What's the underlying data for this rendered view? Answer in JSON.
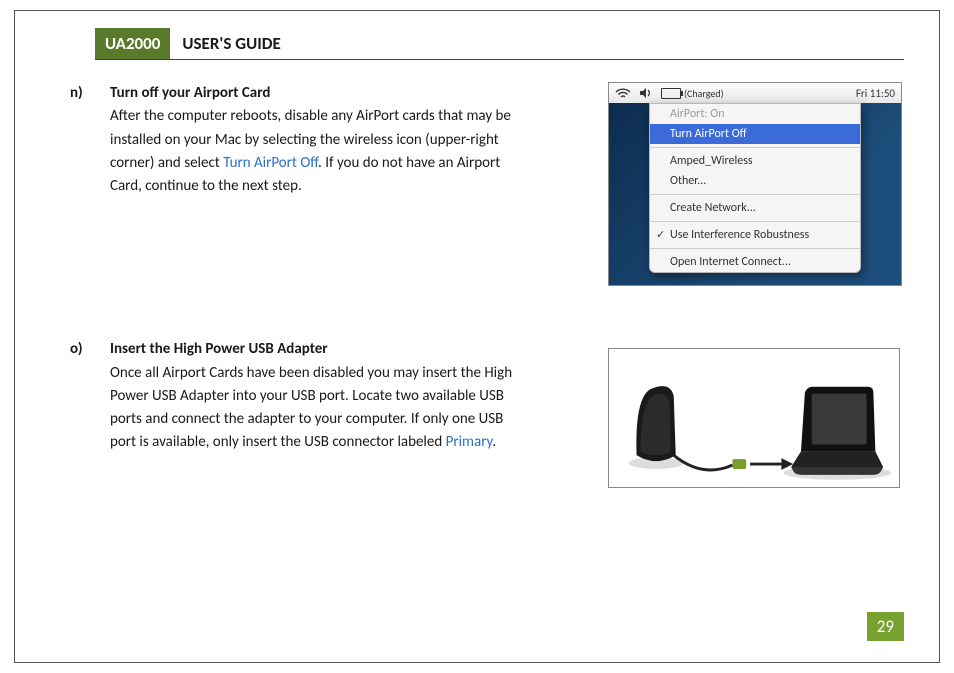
{
  "header": {
    "product": "UA2000",
    "title": "USER'S GUIDE"
  },
  "step_n": {
    "letter": "n)",
    "title": "Turn off your Airport Card",
    "body_pre": "After the computer reboots, disable any AirPort cards that may be installed on your Mac by selecting the wireless icon (upper-right corner) and select ",
    "link": "Turn AirPort Off",
    "body_post": ". If you do not have an Airport Card, continue to the next step."
  },
  "mac_menu": {
    "battery_text": "(Charged)",
    "clock": "Fri 11:50",
    "items": {
      "status": "AirPort: On",
      "turn_off": "Turn AirPort Off",
      "network1": "Amped_Wireless",
      "other": "Other...",
      "create": "Create Network...",
      "interference": "Use Interference Robustness",
      "open_ic": "Open Internet Connect..."
    }
  },
  "step_o": {
    "letter": "o)",
    "title": "Insert the High Power USB Adapter",
    "body_pre": "Once all Airport Cards have been disabled you may insert the High Power USB Adapter into your USB port. Locate two available USB ports and connect the adapter to your computer. If only one USB port is available, only insert the USB connector labeled ",
    "link": "Primary",
    "body_post": "."
  },
  "page_number": "29"
}
